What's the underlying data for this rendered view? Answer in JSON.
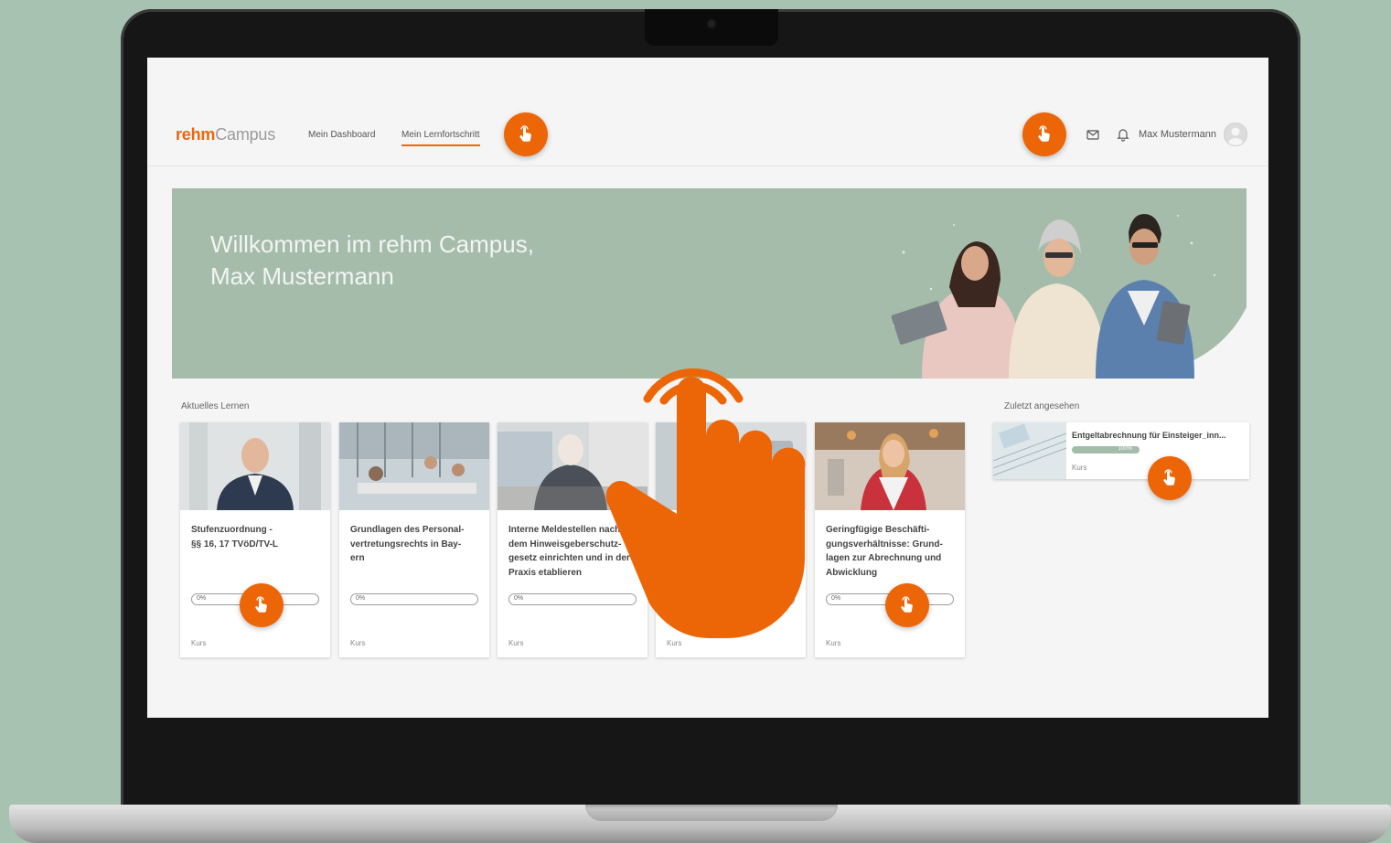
{
  "header": {
    "logo_bold": "rehm",
    "logo_light": "Campus",
    "nav": [
      "Mein Dashboard",
      "Mein Lernfortschritt"
    ],
    "user_name": "Max Mustermann"
  },
  "hero": {
    "line1": "Willkommen im rehm Campus,",
    "line2": "Max Mustermann"
  },
  "current_learning": {
    "label": "Aktuelles Lernen",
    "cards": [
      {
        "title": "Stufenzuordnung -\n§§ 16, 17 TVöD/TV-L",
        "progress": "0%",
        "kind": "Kurs"
      },
      {
        "title": "Grundlagen des Personal-\nvertretungsrechts in Bay-\nern",
        "progress": "0%",
        "kind": "Kurs"
      },
      {
        "title": "Interne Meldestellen nach\ndem Hinweisgeberschutz-\ngesetz einrichten und in der\nPraxis etablieren",
        "progress": "0%",
        "kind": "Kurs"
      },
      {
        "title": "",
        "progress": "0%",
        "kind": "Kurs"
      },
      {
        "title": "Geringfügige Beschäfti-\ngungsverhältnisse: Grund-\nlagen zur Abrechnung und\nAbwicklung",
        "progress": "0%",
        "kind": "Kurs"
      }
    ]
  },
  "recently_viewed": {
    "label": "Zuletzt angesehen",
    "item": {
      "title": "Entgeltabrechnung für Einsteiger_inn...",
      "progress": "100%",
      "kind": "Kurs"
    }
  },
  "colors": {
    "accent": "#ec6608",
    "hero_bg": "#a5bcab",
    "background": "#a8c2b2"
  },
  "icons": [
    "tap-hand-icon",
    "mail-icon",
    "bell-icon",
    "user-avatar-icon"
  ]
}
